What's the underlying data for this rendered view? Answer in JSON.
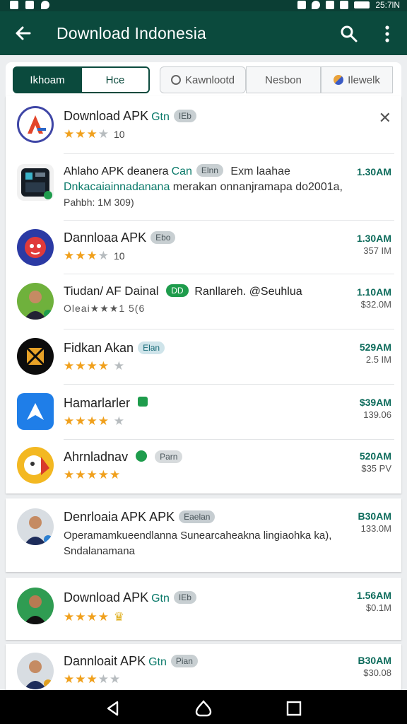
{
  "status_bar": {
    "time": "25:7lN"
  },
  "app_bar": {
    "title": "Download Indonesia",
    "back_icon": "arrow-left-icon",
    "search_icon": "search-icon",
    "more_icon": "more-vert-icon"
  },
  "tabs": [
    {
      "label": "Ikhoam",
      "active": true
    },
    {
      "label": "Hce",
      "active": false
    },
    {
      "label": "Kawnlootd",
      "active": false
    },
    {
      "label": "Nesbon",
      "active": false
    },
    {
      "label": "Ilewelk",
      "active": false
    }
  ],
  "apps": [
    {
      "title": "Download APK",
      "accent": "Gtn",
      "chip": "IEb",
      "rating_text": "10",
      "stars": 2.5,
      "size": "",
      "size_sub": ""
    },
    {
      "title": "Ahlaho APK deanera",
      "accent": "Can",
      "chip": "Elnn",
      "extra": "Exm laahae",
      "desc_teal": "Dnkacaiainnadanana",
      "desc": "merakan onnanjramapa do2001a,",
      "desc2": "Pahbh: 1M 309)",
      "size": "1.30AM",
      "size_sub": ""
    },
    {
      "title": "Dannloaa APK",
      "chip": "Ebo",
      "rating_text": "10",
      "stars": 3,
      "size": "1.30AM",
      "size_sub": "357 IM"
    },
    {
      "title": "Tiudan/ AF Dainal",
      "badge": "DD",
      "extra": "Ranllareh. @Seuhlua",
      "rating_text": "Oleai★★★1 5(6",
      "size": "1.10AM",
      "size_sub": "$32.0M"
    },
    {
      "title": "Fidkan Akan",
      "chip": "Elan",
      "stars": 4,
      "size": "529AM",
      "size_sub": "2.5 IM"
    },
    {
      "title": "Hamarlarler",
      "stars": 4,
      "size": "$39AM",
      "size_sub": "139.06"
    },
    {
      "title": "Ahrnladnav",
      "chip": "Parn",
      "stars": 4.5,
      "size": "520AM",
      "size_sub": "$35 PV"
    },
    {
      "title": "Denrloaia APK APK",
      "chip": "Eaelan",
      "desc": "Operamamkueendlanna Sunearcaheakna lingiaohka ka),",
      "desc2": "Sndalanamana",
      "size": "B30AM",
      "size_sub": "133.0M"
    },
    {
      "title": "Download APK",
      "accent": "Gtn",
      "chip": "IEb",
      "stars": 4,
      "size": "1.56AM",
      "size_sub": "$0.1M"
    },
    {
      "title": "Dannloait APK",
      "accent": "Gtn",
      "chip": "Pian",
      "stars": 3,
      "size": "B30AM",
      "size_sub": "$30.08"
    }
  ],
  "nav": {
    "back_icon": "nav-back-icon",
    "home_icon": "nav-home-icon",
    "recents_icon": "nav-recents-icon"
  },
  "colors": {
    "primary": "#0b4a3d",
    "accent": "#0b7a6a",
    "star": "#f0a01c"
  }
}
